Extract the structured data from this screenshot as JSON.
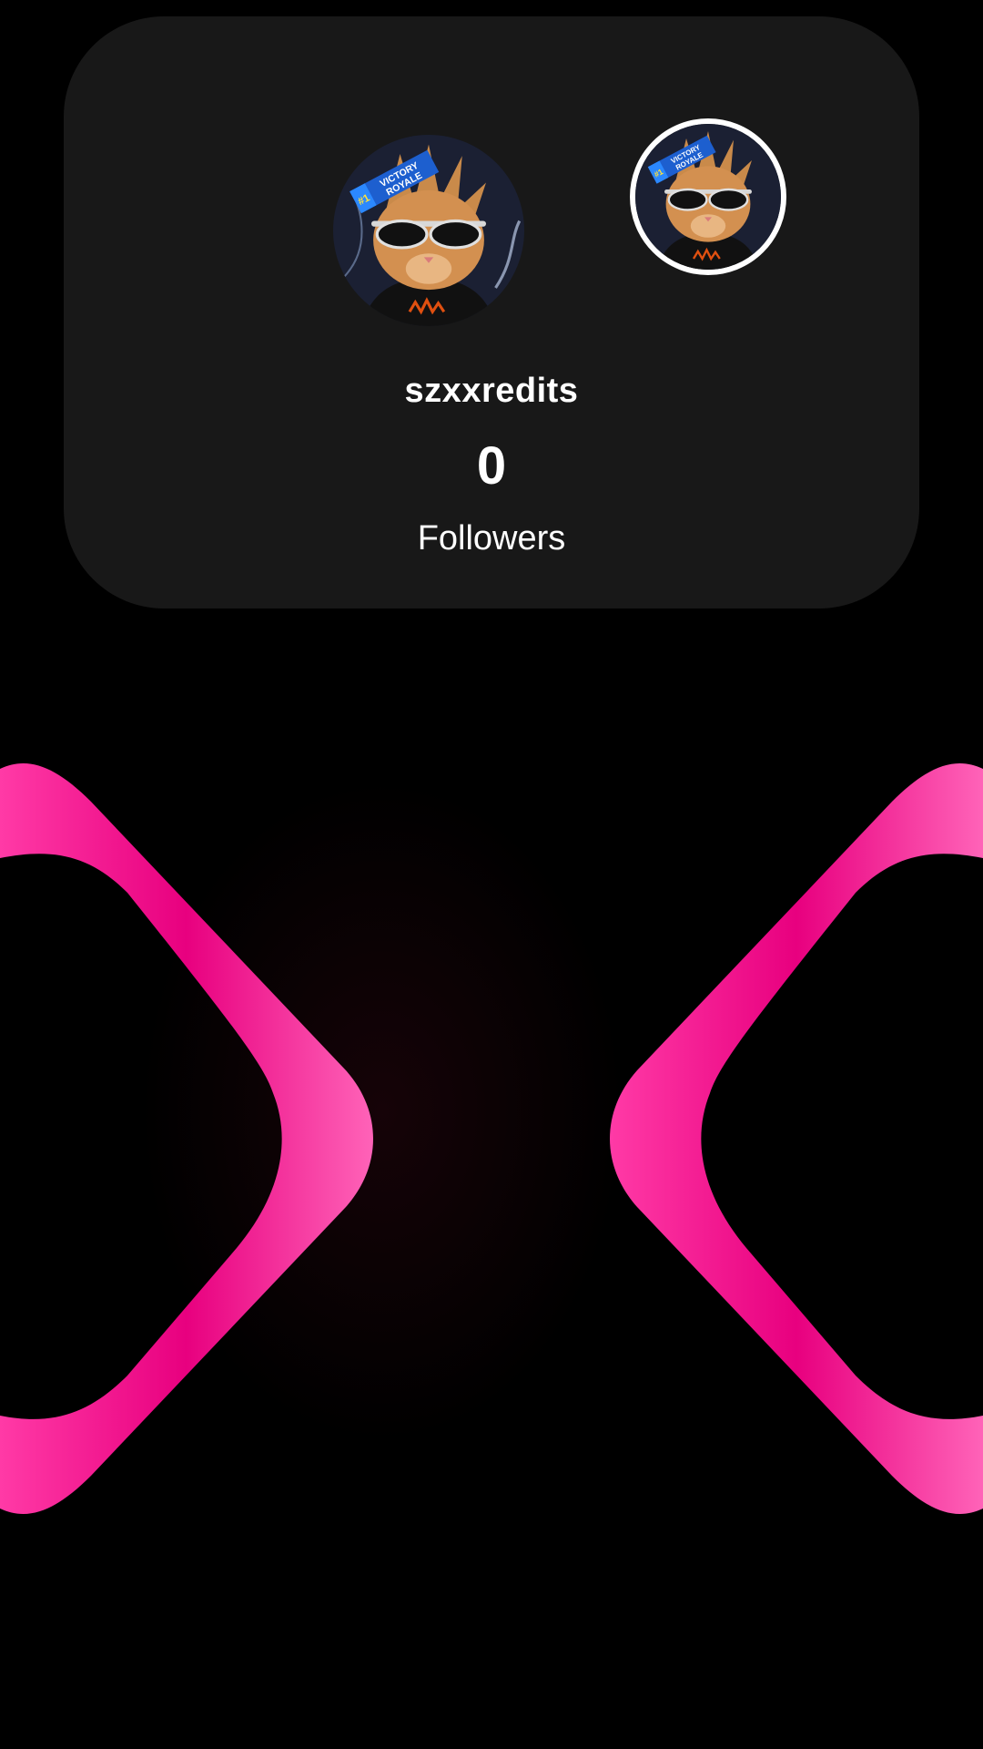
{
  "widget": {
    "username": "szxxredits",
    "follower_count": "0",
    "follower_label": "Followers"
  },
  "avatar": {
    "banner_text_line1": "VICTORY",
    "banner_text_line2": "ROYALE",
    "banner_rank": "#1"
  },
  "colors": {
    "background": "#000000",
    "card": "#181818",
    "accent_pink": "#e8007f",
    "text": "#ffffff"
  },
  "icons": {
    "main_avatar": "cat-sunglasses-avatar",
    "small_avatar": "cat-sunglasses-avatar"
  }
}
